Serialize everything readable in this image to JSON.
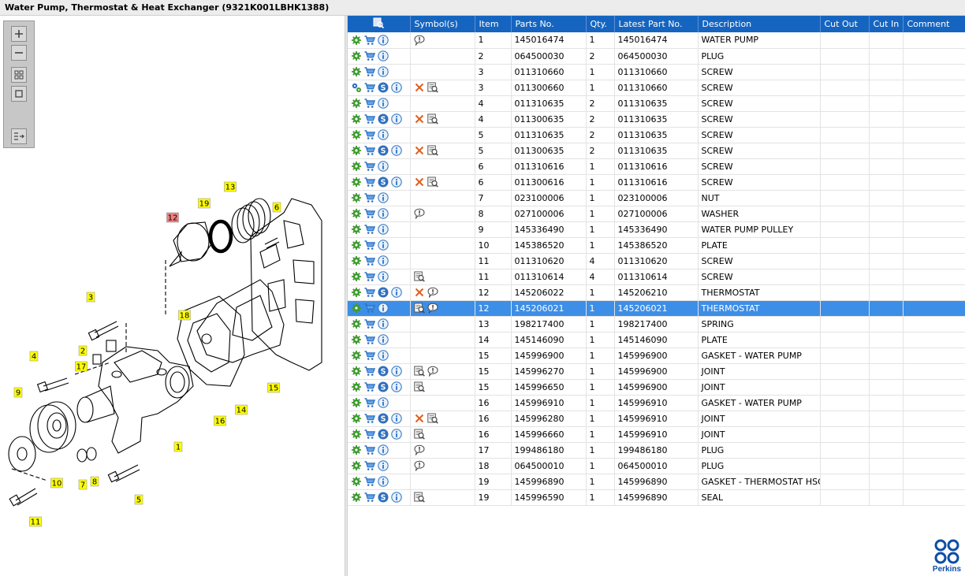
{
  "window": {
    "title": "Water Pump, Thermostat & Heat Exchanger (9321K001LBHK1388)"
  },
  "toolbox": {
    "buttons": [
      "zoom-in",
      "zoom-out",
      "fit-all",
      "fit-window",
      "list-view"
    ]
  },
  "diagram": {
    "callouts": [
      {
        "label": "12",
        "highlighted": true
      },
      {
        "label": "19",
        "highlighted": false
      },
      {
        "label": "13",
        "highlighted": false
      },
      {
        "label": "6",
        "highlighted": false
      },
      {
        "label": "3",
        "highlighted": false
      },
      {
        "label": "18",
        "highlighted": false
      },
      {
        "label": "2",
        "highlighted": false
      },
      {
        "label": "4",
        "highlighted": false
      },
      {
        "label": "17",
        "highlighted": false
      },
      {
        "label": "9",
        "highlighted": false
      },
      {
        "label": "15",
        "highlighted": false
      },
      {
        "label": "14",
        "highlighted": false
      },
      {
        "label": "16",
        "highlighted": false
      },
      {
        "label": "1",
        "highlighted": false
      },
      {
        "label": "10",
        "highlighted": false
      },
      {
        "label": "7",
        "highlighted": false
      },
      {
        "label": "8",
        "highlighted": false
      },
      {
        "label": "5",
        "highlighted": false
      },
      {
        "label": "11",
        "highlighted": false
      }
    ],
    "colors": {
      "callout": "#ffff00",
      "callout_highlight": "#f08080"
    }
  },
  "table": {
    "header_icon": "search-list-icon",
    "columns": [
      "Symbol(s)",
      "Item",
      "Parts No.",
      "Qty.",
      "Latest Part No.",
      "Description",
      "Cut Out",
      "Cut In",
      "Comment"
    ],
    "rows": [
      {
        "multi": false,
        "s": false,
        "sym": [
          "comment"
        ],
        "item": "1",
        "part": "145016474",
        "qty": "1",
        "latest": "145016474",
        "desc": "WATER PUMP"
      },
      {
        "multi": false,
        "s": false,
        "sym": [],
        "item": "2",
        "part": "064500030",
        "qty": "2",
        "latest": "064500030",
        "desc": "PLUG"
      },
      {
        "multi": false,
        "s": false,
        "sym": [],
        "item": "3",
        "part": "011310660",
        "qty": "1",
        "latest": "011310660",
        "desc": "SCREW"
      },
      {
        "multi": true,
        "s": true,
        "sym": [
          "cross",
          "zoom"
        ],
        "item": "3",
        "part": "011300660",
        "qty": "1",
        "latest": "011310660",
        "desc": "SCREW"
      },
      {
        "multi": false,
        "s": false,
        "sym": [],
        "item": "4",
        "part": "011310635",
        "qty": "2",
        "latest": "011310635",
        "desc": "SCREW"
      },
      {
        "multi": false,
        "s": true,
        "sym": [
          "cross",
          "zoom"
        ],
        "item": "4",
        "part": "011300635",
        "qty": "2",
        "latest": "011310635",
        "desc": "SCREW"
      },
      {
        "multi": false,
        "s": false,
        "sym": [],
        "item": "5",
        "part": "011310635",
        "qty": "2",
        "latest": "011310635",
        "desc": "SCREW"
      },
      {
        "multi": false,
        "s": true,
        "sym": [
          "cross",
          "zoom"
        ],
        "item": "5",
        "part": "011300635",
        "qty": "2",
        "latest": "011310635",
        "desc": "SCREW"
      },
      {
        "multi": false,
        "s": false,
        "sym": [],
        "item": "6",
        "part": "011310616",
        "qty": "1",
        "latest": "011310616",
        "desc": "SCREW"
      },
      {
        "multi": false,
        "s": true,
        "sym": [
          "cross",
          "zoom"
        ],
        "item": "6",
        "part": "011300616",
        "qty": "1",
        "latest": "011310616",
        "desc": "SCREW"
      },
      {
        "multi": false,
        "s": false,
        "sym": [],
        "item": "7",
        "part": "023100006",
        "qty": "1",
        "latest": "023100006",
        "desc": "NUT"
      },
      {
        "multi": false,
        "s": false,
        "sym": [
          "comment"
        ],
        "item": "8",
        "part": "027100006",
        "qty": "1",
        "latest": "027100006",
        "desc": "WASHER"
      },
      {
        "multi": false,
        "s": false,
        "sym": [],
        "item": "9",
        "part": "145336490",
        "qty": "1",
        "latest": "145336490",
        "desc": "WATER PUMP PULLEY"
      },
      {
        "multi": false,
        "s": false,
        "sym": [],
        "item": "10",
        "part": "145386520",
        "qty": "1",
        "latest": "145386520",
        "desc": "PLATE"
      },
      {
        "multi": false,
        "s": false,
        "sym": [],
        "item": "11",
        "part": "011310620",
        "qty": "4",
        "latest": "011310620",
        "desc": "SCREW"
      },
      {
        "multi": false,
        "s": false,
        "sym": [
          "zoom"
        ],
        "item": "11",
        "part": "011310614",
        "qty": "4",
        "latest": "011310614",
        "desc": "SCREW"
      },
      {
        "multi": false,
        "s": true,
        "sym": [
          "cross",
          "comment"
        ],
        "item": "12",
        "part": "145206022",
        "qty": "1",
        "latest": "145206210",
        "desc": "THERMOSTAT"
      },
      {
        "multi": false,
        "s": false,
        "sym": [
          "zoom",
          "comment"
        ],
        "item": "12",
        "part": "145206021",
        "qty": "1",
        "latest": "145206021",
        "desc": "THERMOSTAT",
        "selected": true
      },
      {
        "multi": false,
        "s": false,
        "sym": [],
        "item": "13",
        "part": "198217400",
        "qty": "1",
        "latest": "198217400",
        "desc": "SPRING"
      },
      {
        "multi": false,
        "s": false,
        "sym": [],
        "item": "14",
        "part": "145146090",
        "qty": "1",
        "latest": "145146090",
        "desc": "PLATE"
      },
      {
        "multi": false,
        "s": false,
        "sym": [],
        "item": "15",
        "part": "145996900",
        "qty": "1",
        "latest": "145996900",
        "desc": "GASKET - WATER PUMP"
      },
      {
        "multi": false,
        "s": true,
        "sym": [
          "zoom",
          "comment"
        ],
        "item": "15",
        "part": "145996270",
        "qty": "1",
        "latest": "145996900",
        "desc": "JOINT"
      },
      {
        "multi": false,
        "s": true,
        "sym": [
          "zoom"
        ],
        "item": "15",
        "part": "145996650",
        "qty": "1",
        "latest": "145996900",
        "desc": "JOINT"
      },
      {
        "multi": false,
        "s": false,
        "sym": [],
        "item": "16",
        "part": "145996910",
        "qty": "1",
        "latest": "145996910",
        "desc": "GASKET - WATER PUMP"
      },
      {
        "multi": false,
        "s": true,
        "sym": [
          "cross",
          "zoom"
        ],
        "item": "16",
        "part": "145996280",
        "qty": "1",
        "latest": "145996910",
        "desc": "JOINT"
      },
      {
        "multi": false,
        "s": true,
        "sym": [
          "zoom"
        ],
        "item": "16",
        "part": "145996660",
        "qty": "1",
        "latest": "145996910",
        "desc": "JOINT"
      },
      {
        "multi": false,
        "s": false,
        "sym": [
          "comment"
        ],
        "item": "17",
        "part": "199486180",
        "qty": "1",
        "latest": "199486180",
        "desc": "PLUG"
      },
      {
        "multi": false,
        "s": false,
        "sym": [
          "comment"
        ],
        "item": "18",
        "part": "064500010",
        "qty": "1",
        "latest": "064500010",
        "desc": "PLUG"
      },
      {
        "multi": false,
        "s": false,
        "sym": [],
        "item": "19",
        "part": "145996890",
        "qty": "1",
        "latest": "145996890",
        "desc": "GASKET - THERMOSTAT HSG"
      },
      {
        "multi": false,
        "s": true,
        "sym": [
          "zoom"
        ],
        "item": "19",
        "part": "145996590",
        "qty": "1",
        "latest": "145996890",
        "desc": "SEAL"
      }
    ]
  },
  "logo": {
    "text": "Perkins",
    "color": "#0d4ea6"
  }
}
